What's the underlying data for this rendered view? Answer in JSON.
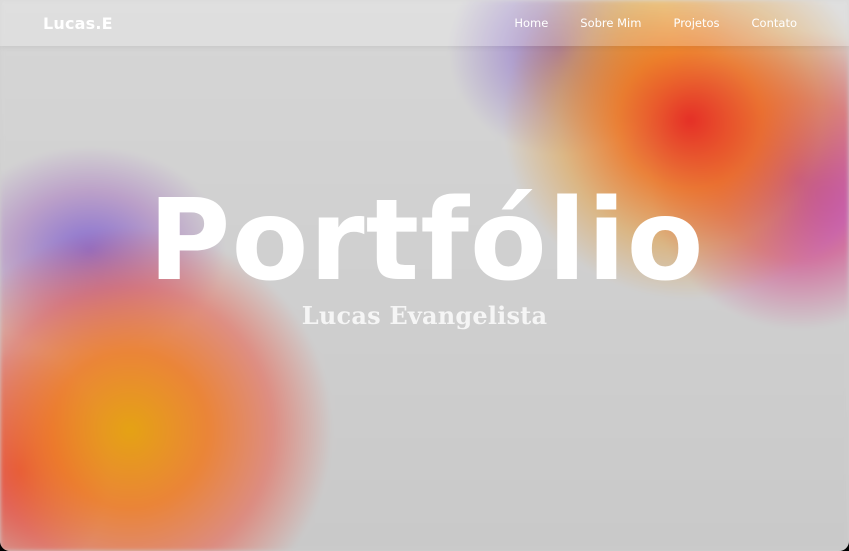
{
  "brand": {
    "logo": "Lucas.E"
  },
  "nav": {
    "items": [
      {
        "label": "Home"
      },
      {
        "label": "Sobre Mim"
      },
      {
        "label": "Projetos"
      },
      {
        "label": "Contato"
      }
    ]
  },
  "hero": {
    "title": "Portfólio",
    "subtitle": "Lucas Evangelista"
  },
  "colors": {
    "text": "#ffffff",
    "background": "#cfcfcf",
    "accent_orange": "#f08020",
    "accent_red": "#e02a1e",
    "accent_purple": "#7050d0",
    "accent_magenta": "#b014c8",
    "accent_yellow": "#e8a00a"
  }
}
